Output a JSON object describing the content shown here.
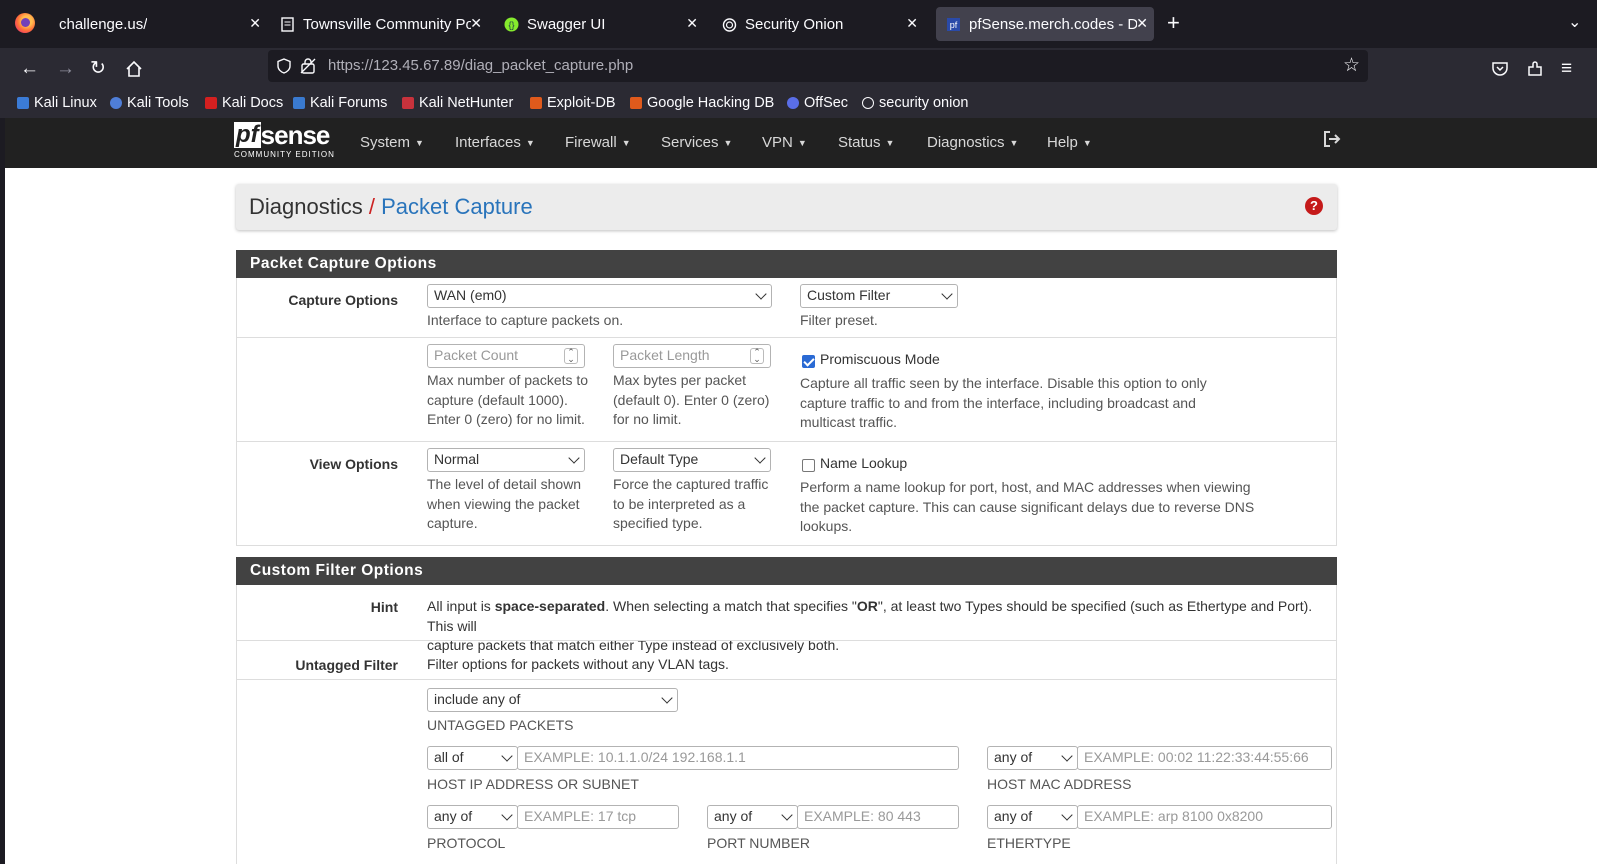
{
  "browser": {
    "tabs": [
      {
        "title": "challenge.us/",
        "active": false
      },
      {
        "title": "Townsville Community Po",
        "active": false
      },
      {
        "title": "Swagger UI",
        "active": false
      },
      {
        "title": "Security Onion",
        "active": false
      },
      {
        "title": "pfSense.merch.codes - Di",
        "active": true
      }
    ],
    "url_host": "https://123.45.67.89",
    "url_path": "/diag_packet_capture.php",
    "bookmarks": [
      "Kali Linux",
      "Kali Tools",
      "Kali Docs",
      "Kali Forums",
      "Kali NetHunter",
      "Exploit-DB",
      "Google Hacking DB",
      "OffSec",
      "security onion"
    ]
  },
  "pfsense": {
    "logo_word": "sense",
    "logo_box": "pf",
    "edition": "COMMUNITY EDITION",
    "menu": [
      "System",
      "Interfaces",
      "Firewall",
      "Services",
      "VPN",
      "Status",
      "Diagnostics",
      "Help"
    ]
  },
  "breadcrumb": {
    "parent": "Diagnostics",
    "separator": "/",
    "current": "Packet Capture"
  },
  "capture_panel": {
    "title": "Packet Capture Options",
    "capture_options": {
      "label": "Capture Options",
      "interface_value": "WAN (em0)",
      "interface_help": "Interface to capture packets on.",
      "filter_value": "Custom Filter",
      "filter_help": "Filter preset."
    },
    "counts": {
      "packet_count_placeholder": "Packet Count",
      "packet_count_help": [
        "Max number of packets to",
        "capture (default 1000).",
        "Enter 0 (zero) for no limit."
      ],
      "packet_length_placeholder": "Packet Length",
      "packet_length_help": [
        "Max bytes per packet",
        "(default 0). Enter 0 (zero)",
        "for no limit."
      ],
      "promiscuous_label": "Promiscuous Mode",
      "promiscuous_checked": true,
      "promiscuous_help": [
        "Capture all traffic seen by the interface. Disable this option to only",
        "capture traffic to and from the interface, including broadcast and",
        "multicast traffic."
      ]
    },
    "view_options": {
      "label": "View Options",
      "detail_value": "Normal",
      "detail_help": [
        "The level of detail shown",
        "when viewing the packet",
        "capture."
      ],
      "type_value": "Default Type",
      "type_help": [
        "Force the captured traffic",
        "to be interpreted as a",
        "specified type."
      ],
      "name_lookup_label": "Name Lookup",
      "name_lookup_checked": false,
      "name_lookup_help": [
        "Perform a name lookup for port, host, and MAC addresses when viewing",
        "the packet capture. This can cause significant delays due to reverse DNS",
        "lookups."
      ]
    }
  },
  "filter_panel": {
    "title": "Custom Filter Options",
    "hint_label": "Hint",
    "hint_pre": "All input is ",
    "hint_bold1": "space-separated",
    "hint_mid": ". When selecting a match that specifies \"",
    "hint_bold2": "OR",
    "hint_post": "\", at least two Types should be specified (such as Ethertype and Port). This will",
    "hint_line2": "capture packets that match either Type instead of exclusively both.",
    "untagged_label": "Untagged Filter",
    "untagged_help": "Filter options for packets without any VLAN tags.",
    "untagged_match_value": "include any of",
    "untagged_caption": "UNTAGGED PACKETS",
    "host_match_value": "all of",
    "host_placeholder": "EXAMPLE: 10.1.1.0/24 192.168.1.1",
    "host_caption": "HOST IP ADDRESS OR SUBNET",
    "mac_match_value": "any of",
    "mac_placeholder": "EXAMPLE: 00:02 11:22:33:44:55:66",
    "mac_caption": "HOST MAC ADDRESS",
    "proto_match_value": "any of",
    "proto_placeholder": "EXAMPLE: 17 tcp",
    "proto_caption": "PROTOCOL",
    "port_match_value": "any of",
    "port_placeholder": "EXAMPLE: 80 443",
    "port_caption": "PORT NUMBER",
    "ether_match_value": "any of",
    "ether_placeholder": "EXAMPLE: arp 8100 0x8200",
    "ether_caption": "ETHERTYPE"
  }
}
